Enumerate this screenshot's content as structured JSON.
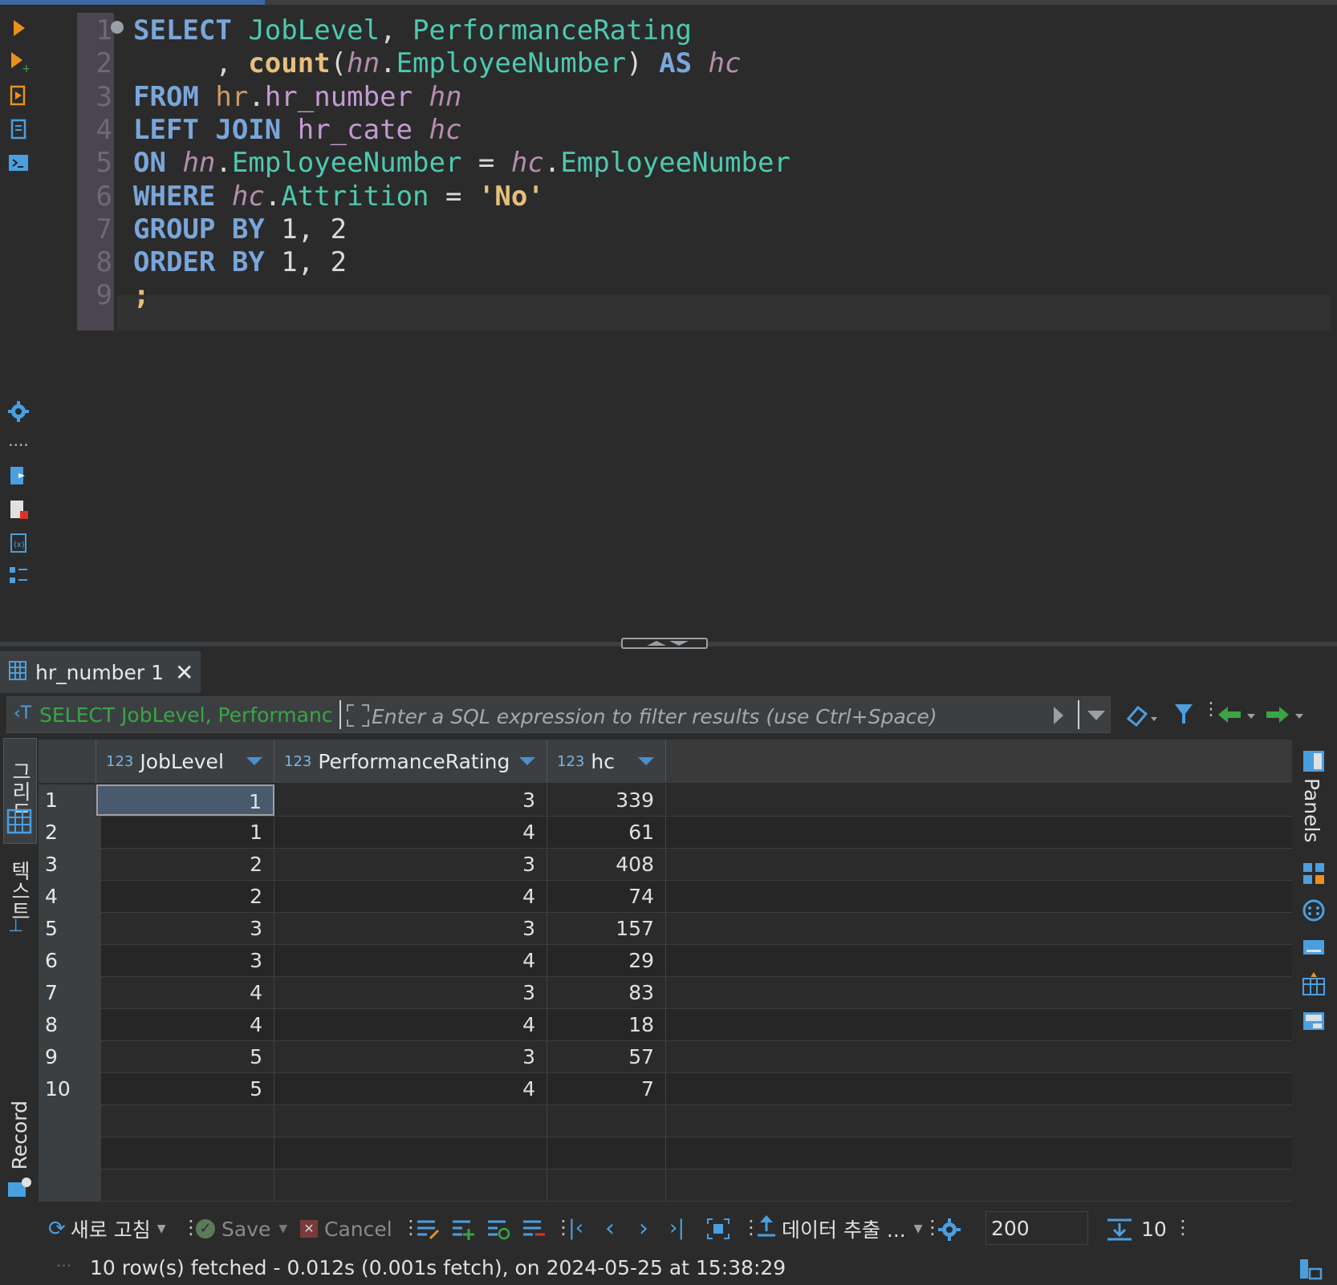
{
  "editor": {
    "line_numbers": [
      "1",
      "2",
      "3",
      "4",
      "5",
      "6",
      "7",
      "8",
      "9"
    ],
    "lines": [
      [
        {
          "t": "SELECT",
          "c": "kw"
        },
        {
          "t": " ",
          "c": "punc"
        },
        {
          "t": "JobLevel",
          "c": "ident"
        },
        {
          "t": ", ",
          "c": "punc"
        },
        {
          "t": "PerformanceRating",
          "c": "ident"
        }
      ],
      [
        {
          "t": "     , ",
          "c": "punc"
        },
        {
          "t": "count",
          "c": "fn"
        },
        {
          "t": "(",
          "c": "punc"
        },
        {
          "t": "hn",
          "c": "alias"
        },
        {
          "t": ".",
          "c": "punc"
        },
        {
          "t": "EmployeeNumber",
          "c": "ident"
        },
        {
          "t": ") ",
          "c": "punc"
        },
        {
          "t": "AS",
          "c": "kw"
        },
        {
          "t": " ",
          "c": "punc"
        },
        {
          "t": "hc",
          "c": "alias"
        }
      ],
      [
        {
          "t": "FROM",
          "c": "kw"
        },
        {
          "t": " ",
          "c": "punc"
        },
        {
          "t": "hr",
          "c": "sch"
        },
        {
          "t": ".",
          "c": "punc"
        },
        {
          "t": "hr_number",
          "c": "tbl"
        },
        {
          "t": " ",
          "c": "punc"
        },
        {
          "t": "hn",
          "c": "alias"
        }
      ],
      [
        {
          "t": "LEFT JOIN",
          "c": "kw"
        },
        {
          "t": " ",
          "c": "punc"
        },
        {
          "t": "hr_cate",
          "c": "tbl"
        },
        {
          "t": " ",
          "c": "punc"
        },
        {
          "t": "hc",
          "c": "alias"
        }
      ],
      [
        {
          "t": "ON",
          "c": "kw"
        },
        {
          "t": " ",
          "c": "punc"
        },
        {
          "t": "hn",
          "c": "alias"
        },
        {
          "t": ".",
          "c": "punc"
        },
        {
          "t": "EmployeeNumber",
          "c": "ident"
        },
        {
          "t": " = ",
          "c": "punc"
        },
        {
          "t": "hc",
          "c": "alias"
        },
        {
          "t": ".",
          "c": "punc"
        },
        {
          "t": "EmployeeNumber",
          "c": "ident"
        }
      ],
      [
        {
          "t": "WHERE",
          "c": "kw"
        },
        {
          "t": " ",
          "c": "punc"
        },
        {
          "t": "hc",
          "c": "alias"
        },
        {
          "t": ".",
          "c": "punc"
        },
        {
          "t": "Attrition",
          "c": "ident"
        },
        {
          "t": " = ",
          "c": "punc"
        },
        {
          "t": "'No'",
          "c": "str"
        }
      ],
      [
        {
          "t": "GROUP BY",
          "c": "kw"
        },
        {
          "t": " 1, 2",
          "c": "num"
        }
      ],
      [
        {
          "t": "ORDER BY",
          "c": "kw"
        },
        {
          "t": " 1, 2",
          "c": "num"
        }
      ],
      [
        {
          "t": ";",
          "c": "str"
        }
      ]
    ]
  },
  "result_tab": {
    "title": "hr_number 1",
    "close": "✕"
  },
  "filter": {
    "query_preview": "SELECT JobLevel, Performanc",
    "placeholder": "Enter a SQL expression to filter results (use Ctrl+Space)"
  },
  "side_tabs": {
    "grid": "그리드",
    "text": "텍스트",
    "record": "Record",
    "panels": "Panels"
  },
  "grid": {
    "columns": [
      {
        "type": "123",
        "name": "JobLevel"
      },
      {
        "type": "123",
        "name": "PerformanceRating"
      },
      {
        "type": "123",
        "name": "hc"
      }
    ],
    "rows": [
      {
        "n": "1",
        "v": [
          "1",
          "3",
          "339"
        ]
      },
      {
        "n": "2",
        "v": [
          "1",
          "4",
          "61"
        ]
      },
      {
        "n": "3",
        "v": [
          "2",
          "3",
          "408"
        ]
      },
      {
        "n": "4",
        "v": [
          "2",
          "4",
          "74"
        ]
      },
      {
        "n": "5",
        "v": [
          "3",
          "3",
          "157"
        ]
      },
      {
        "n": "6",
        "v": [
          "3",
          "4",
          "29"
        ]
      },
      {
        "n": "7",
        "v": [
          "4",
          "3",
          "83"
        ]
      },
      {
        "n": "8",
        "v": [
          "4",
          "4",
          "18"
        ]
      },
      {
        "n": "9",
        "v": [
          "5",
          "3",
          "57"
        ]
      },
      {
        "n": "10",
        "v": [
          "5",
          "4",
          "7"
        ]
      }
    ],
    "empty_rows": 3
  },
  "toolbar": {
    "refresh": "새로 고침",
    "save": "Save",
    "cancel": "Cancel",
    "export": "데이터 추출 ...",
    "fetch_size": "200",
    "row_count": "10"
  },
  "status": {
    "text": "10 row(s) fetched - 0.012s (0.001s fetch), on 2024-05-25 at 15:38:29"
  },
  "colors": {
    "accent": "#3d6aa3",
    "keyword": "#7aa6da",
    "identifier": "#4ec9b0",
    "string": "#e5c07b",
    "query_green": "#3aa544"
  }
}
